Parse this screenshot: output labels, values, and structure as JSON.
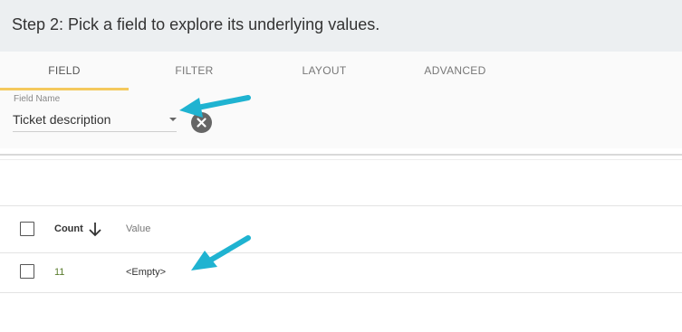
{
  "header": {
    "title": "Step 2: Pick a field to explore its underlying values."
  },
  "tabs": [
    {
      "label": "FIELD",
      "active": true
    },
    {
      "label": "FILTER",
      "active": false
    },
    {
      "label": "LAYOUT",
      "active": false
    },
    {
      "label": "ADVANCED",
      "active": false
    }
  ],
  "field": {
    "label": "Field Name",
    "value": "Ticket description"
  },
  "table": {
    "columns": {
      "count": "Count",
      "value": "Value"
    },
    "rows": [
      {
        "count": "11",
        "value": "<Empty>"
      }
    ]
  },
  "colors": {
    "accent_underline": "#f4c95d",
    "annotation_arrow": "#1fb3d1",
    "count_text": "#5a7d2e"
  },
  "icons": [
    "dropdown-arrow-icon",
    "clear-icon",
    "sort-down-icon",
    "annotation-arrow-icon"
  ]
}
